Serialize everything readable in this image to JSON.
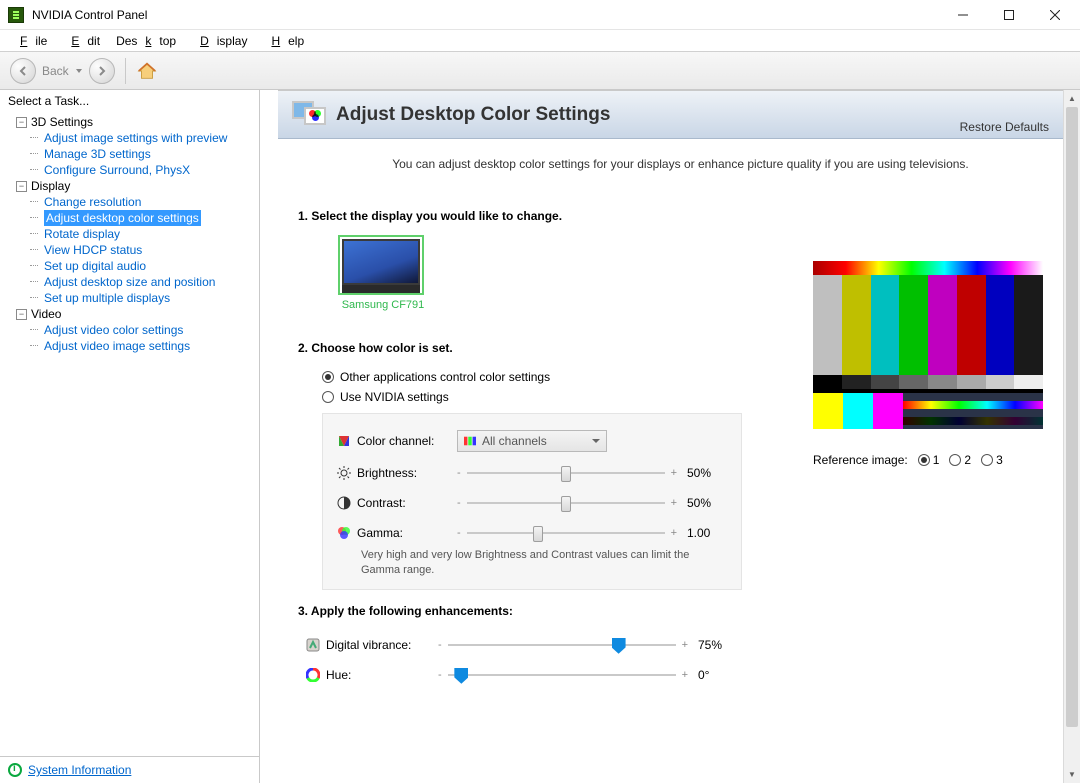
{
  "window": {
    "title": "NVIDIA Control Panel"
  },
  "menu": {
    "file": "File",
    "edit": "Edit",
    "desktop": "Desktop",
    "display": "Display",
    "help": "Help"
  },
  "toolbar": {
    "back": "Back"
  },
  "sidebar": {
    "heading": "Select a Task...",
    "cat1": "3D Settings",
    "cat1_items": {
      "0": "Adjust image settings with preview",
      "1": "Manage 3D settings",
      "2": "Configure Surround, PhysX"
    },
    "cat2": "Display",
    "cat2_items": {
      "0": "Change resolution",
      "1": "Adjust desktop color settings",
      "2": "Rotate display",
      "3": "View HDCP status",
      "4": "Set up digital audio",
      "5": "Adjust desktop size and position",
      "6": "Set up multiple displays"
    },
    "cat3": "Video",
    "cat3_items": {
      "0": "Adjust video color settings",
      "1": "Adjust video image settings"
    },
    "sysinfo": "System Information"
  },
  "page": {
    "title": "Adjust Desktop Color Settings",
    "restore": "Restore Defaults",
    "intro": "You can adjust desktop color settings for your displays or enhance picture quality if you are using televisions.",
    "sec1": "1. Select the display you would like to change.",
    "display_name": "Samsung CF791",
    "sec2": "2. Choose how color is set.",
    "radio_other": "Other applications control color settings",
    "radio_nvidia": "Use NVIDIA settings",
    "color_channel_label": "Color channel:",
    "color_channel_value": "All channels",
    "brightness_label": "Brightness:",
    "brightness_value": "50%",
    "contrast_label": "Contrast:",
    "contrast_value": "50%",
    "gamma_label": "Gamma:",
    "gamma_value": "1.00",
    "hint": "Very high and very low Brightness and Contrast values can limit the Gamma range.",
    "sec3": "3. Apply the following enhancements:",
    "vibrance_label": "Digital vibrance:",
    "vibrance_value": "75%",
    "hue_label": "Hue:",
    "hue_value": "0°",
    "ref_label": "Reference image:",
    "ref1": "1",
    "ref2": "2",
    "ref3": "3"
  }
}
